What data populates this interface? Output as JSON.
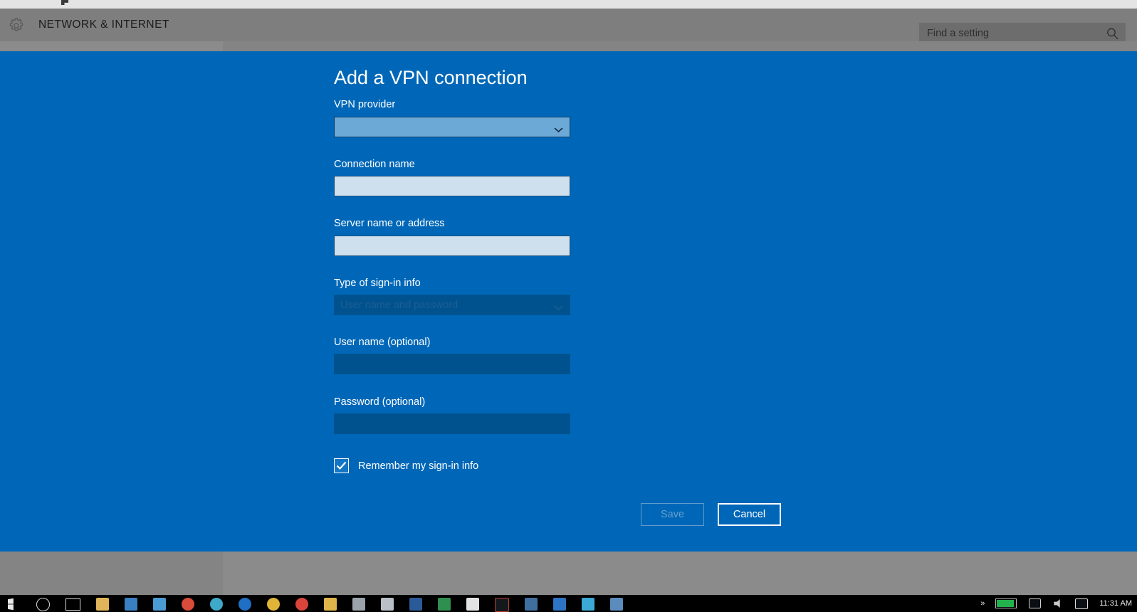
{
  "window": {
    "header_title": "NETWORK & INTERNET",
    "gear_icon": "gear-icon"
  },
  "search": {
    "placeholder": "Find a setting",
    "value": "",
    "icon": "search-icon"
  },
  "page": {
    "title": "Add a VPN connection"
  },
  "form": {
    "vpn_provider": {
      "label": "VPN provider",
      "value": "",
      "enabled": true,
      "chevron": "chevron-down-icon"
    },
    "connection_name": {
      "label": "Connection name",
      "value": "",
      "placeholder": ""
    },
    "server_name": {
      "label": "Server name or address",
      "value": "",
      "placeholder": ""
    },
    "signin_type": {
      "label": "Type of sign-in info",
      "value": "User name and password",
      "enabled": false,
      "chevron": "chevron-down-icon"
    },
    "user_name": {
      "label": "User name (optional)",
      "value": "",
      "enabled": false
    },
    "password": {
      "label": "Password (optional)",
      "value": "",
      "enabled": false
    },
    "remember": {
      "label": "Remember my sign-in info",
      "checked": true
    }
  },
  "actions": {
    "save_label": "Save",
    "save_enabled": false,
    "cancel_label": "Cancel",
    "cancel_enabled": true
  },
  "colors": {
    "accent_blue": "#0067b8",
    "header_grey": "#7e7e7e",
    "input_fill": "#cedfee",
    "combo_fill": "#6da9d7",
    "disabled_fill": "#00528f",
    "battery_green": "#22b14c"
  },
  "taskbar": {
    "icons": [
      {
        "name": "start-icon",
        "color": "#e8e8e8"
      },
      {
        "name": "cortana-search-icon",
        "color": "#d8d8d8"
      },
      {
        "name": "task-view-icon",
        "color": "#d8d8d8"
      },
      {
        "name": "file-explorer-icon",
        "color": "#dfb45a"
      },
      {
        "name": "app-icon-blue-1",
        "color": "#3a7fc1"
      },
      {
        "name": "app-icon-blue-2",
        "color": "#4a9ad4"
      },
      {
        "name": "app-icon-red",
        "color": "#d94b3a"
      },
      {
        "name": "app-icon-teal",
        "color": "#3fa9c9"
      },
      {
        "name": "app-icon-edge",
        "color": "#1f6fc4"
      },
      {
        "name": "app-icon-yellow",
        "color": "#e0b437"
      },
      {
        "name": "app-icon-orange",
        "color": "#d9453a"
      },
      {
        "name": "app-icon-folder",
        "color": "#e0b44a"
      },
      {
        "name": "app-icon-grey",
        "color": "#9aa3ab"
      },
      {
        "name": "app-icon-silver",
        "color": "#b8bfc6"
      },
      {
        "name": "app-icon-navy",
        "color": "#2b5a99"
      },
      {
        "name": "app-icon-green",
        "color": "#2f8f4e"
      },
      {
        "name": "app-icon-white",
        "color": "#e3e3e3"
      },
      {
        "name": "app-icon-outline-red",
        "color": "#c23b30"
      },
      {
        "name": "app-icon-steel",
        "color": "#3f6f9e"
      },
      {
        "name": "app-icon-blue-3",
        "color": "#2d74c4"
      },
      {
        "name": "app-icon-cyan",
        "color": "#3ba9d6"
      },
      {
        "name": "app-icon-mixed",
        "color": "#5b8cbd"
      }
    ],
    "tray": {
      "overflow_label": "»",
      "battery": "battery-icon",
      "network": "network-icon",
      "volume": "volume-icon",
      "action_center": "action-center-icon",
      "clock": "11:31 AM"
    }
  }
}
